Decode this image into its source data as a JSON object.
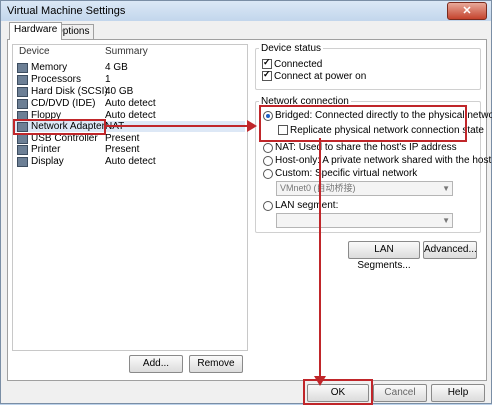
{
  "window": {
    "title": "Virtual Machine Settings",
    "close_label": "✕"
  },
  "tabs": [
    {
      "label": "Hardware"
    },
    {
      "label": "Options"
    }
  ],
  "device_list": {
    "headers": {
      "device": "Device",
      "summary": "Summary"
    },
    "rows": [
      {
        "device": "Memory",
        "summary": "4 GB"
      },
      {
        "device": "Processors",
        "summary": "1"
      },
      {
        "device": "Hard Disk (SCSI)",
        "summary": "40 GB"
      },
      {
        "device": "CD/DVD (IDE)",
        "summary": "Auto detect"
      },
      {
        "device": "Floppy",
        "summary": "Auto detect"
      },
      {
        "device": "Network Adapter",
        "summary": "NAT"
      },
      {
        "device": "USB Controller",
        "summary": "Present"
      },
      {
        "device": "Printer",
        "summary": "Present"
      },
      {
        "device": "Display",
        "summary": "Auto detect"
      }
    ],
    "selected_index": 5,
    "add_label": "Add...",
    "remove_label": "Remove"
  },
  "device_status": {
    "title": "Device status",
    "connected": "Connected",
    "connect_at_power_on": "Connect at power on"
  },
  "network_connection": {
    "title": "Network connection",
    "bridged": "Bridged: Connected directly to the physical network",
    "replicate": "Replicate physical network connection state",
    "nat": "NAT: Used to share the host's IP address",
    "host_only": "Host-only: A private network shared with the host",
    "custom": "Custom: Specific virtual network",
    "custom_value": "VMnet0 (自动桥接)",
    "lan_segment": "LAN segment:",
    "lan_segments_button": "LAN Segments...",
    "advanced_button": "Advanced..."
  },
  "footer": {
    "ok": "OK",
    "cancel": "Cancel",
    "help": "Help"
  },
  "colors": {
    "annotation_red": "#c0262a",
    "selection": "#dde8f6"
  }
}
